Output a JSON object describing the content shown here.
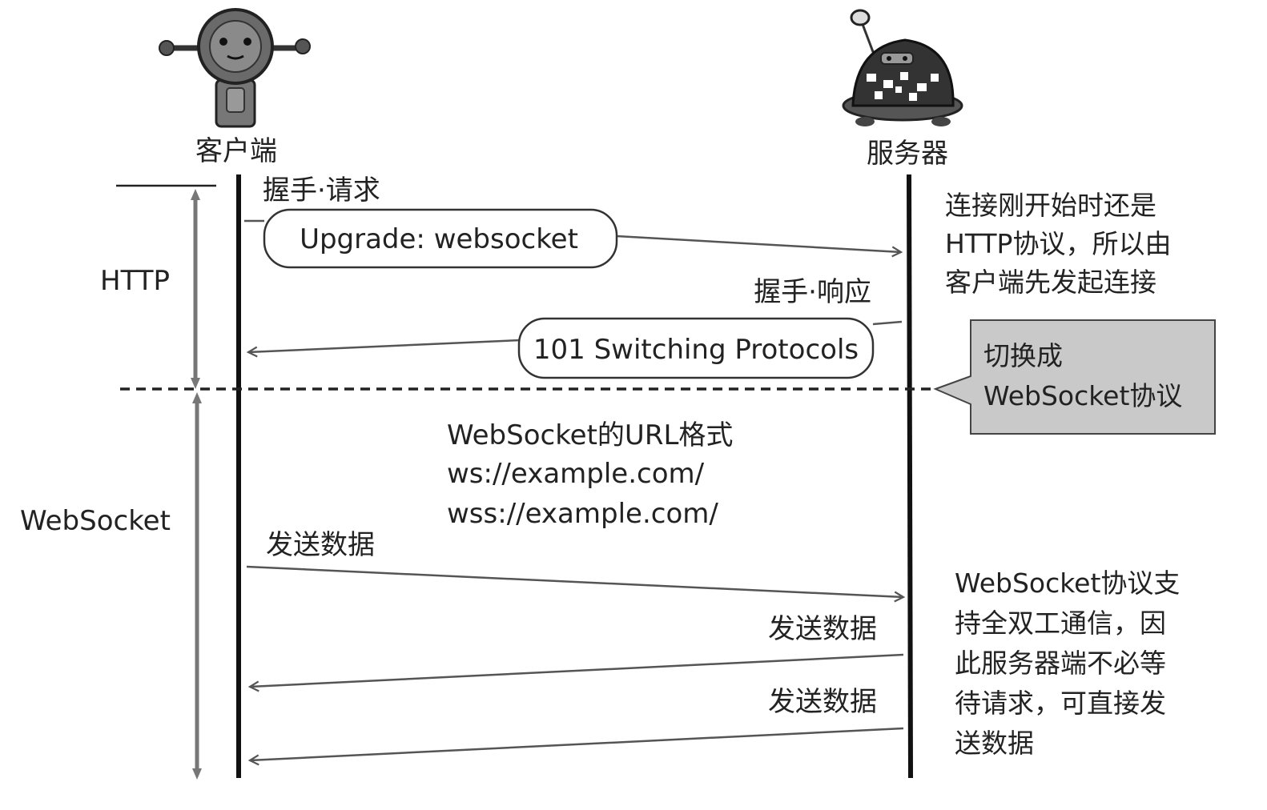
{
  "actors": {
    "client": "客户端",
    "server": "服务器"
  },
  "phases": {
    "http": "HTTP",
    "websocket": "WebSocket"
  },
  "messages": {
    "handshake_request_label": "握手·请求",
    "handshake_request_box": "Upgrade: websocket",
    "handshake_response_label": "握手·响应",
    "handshake_response_box": "101 Switching Protocols",
    "send_data_1": "发送数据",
    "send_data_2": "发送数据",
    "send_data_3": "发送数据"
  },
  "url_format": {
    "title": "WebSocket的URL格式",
    "ws": "ws://example.com/",
    "wss": "wss://example.com/"
  },
  "notes": {
    "http_note": [
      "连接刚开始时还是",
      "HTTP协议，所以由",
      "客户端先发起连接"
    ],
    "switch_note": [
      "切换成",
      "WebSocket协议"
    ],
    "full_duplex_note": [
      "WebSocket协议支",
      "持全双工通信，因",
      "此服务器端不必等",
      "待请求，可直接发",
      "送数据"
    ]
  },
  "colors": {
    "line": "#111111",
    "arrow": "#555555",
    "callout_fill": "#c9c9c9"
  }
}
